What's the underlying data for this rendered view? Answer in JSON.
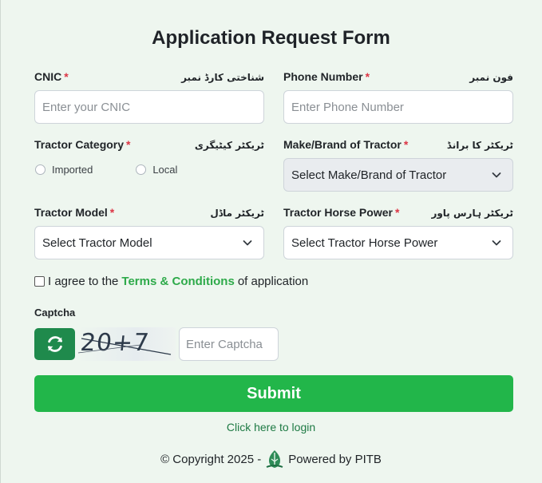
{
  "form": {
    "title": "Application Request Form"
  },
  "fields": {
    "cnic": {
      "label": "CNIC",
      "required": "*",
      "urdu": "شناختی کارڈ نمبر",
      "placeholder": "Enter your CNIC"
    },
    "phone": {
      "label": "Phone Number",
      "required": "*",
      "urdu": "فون نمبر",
      "placeholder": "Enter Phone Number"
    },
    "category": {
      "label": "Tractor Category",
      "required": "*",
      "urdu": "ٹریکٹر کیٹیگری",
      "options": [
        "Imported",
        "Local"
      ]
    },
    "brand": {
      "label": "Make/Brand of Tractor",
      "required": "*",
      "urdu": "ٹریکٹر کا برانڈ",
      "selected": "Select Make/Brand of Tractor"
    },
    "model": {
      "label": "Tractor Model",
      "required": "*",
      "urdu": "ٹریکٹر ماڈل",
      "selected": "Select Tractor Model"
    },
    "horsepower": {
      "label": "Tractor Horse Power",
      "required": "*",
      "urdu": "ٹریکٹر ہارس پاور",
      "selected": "Select Tractor Horse Power"
    }
  },
  "agree": {
    "prefix": "I agree to the",
    "link": "Terms & Conditions",
    "suffix": "of application"
  },
  "captcha": {
    "label": "Captcha",
    "text": "20+7 =",
    "placeholder": "Enter Captcha"
  },
  "submit": {
    "label": "Submit"
  },
  "login": {
    "label": "Click here to login"
  },
  "footer": {
    "copyright": "© Copyright 2025 -",
    "powered": "Powered by PITB"
  },
  "colors": {
    "accent": "#22b64a",
    "refresh": "#1f8a4c",
    "link": "#2eaa4a",
    "required": "#dc3545"
  }
}
